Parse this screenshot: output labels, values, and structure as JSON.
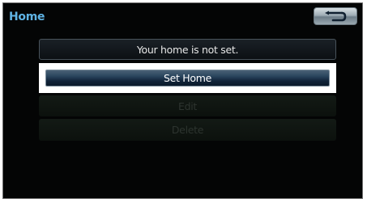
{
  "screen": {
    "title": "Home"
  },
  "back_button": {
    "icon": "back-arrow-icon"
  },
  "status": {
    "message": "Your home is not set."
  },
  "buttons": {
    "set_home": "Set Home",
    "edit": "Edit",
    "delete": "Delete"
  },
  "colors": {
    "title": "#5fb3e4",
    "highlight": "#ffffff",
    "selected_button": "#1d344b"
  }
}
